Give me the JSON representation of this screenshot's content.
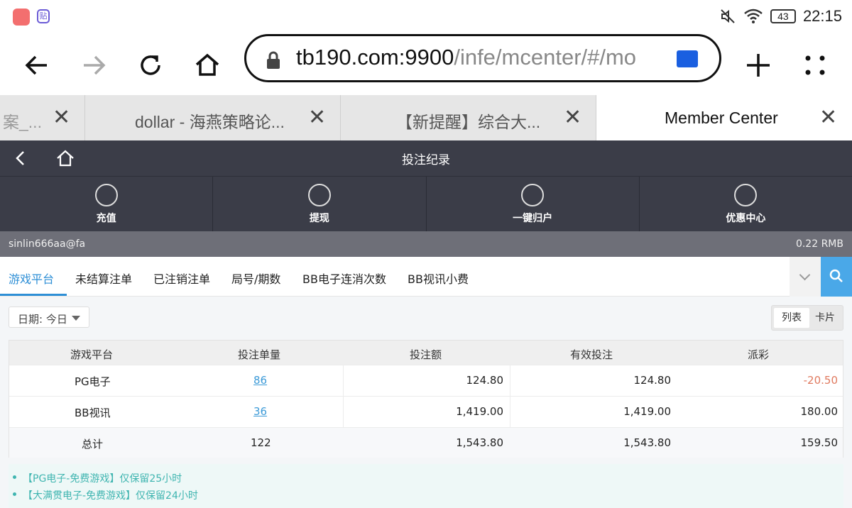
{
  "statusbar": {
    "app_badge": "贴",
    "battery": "43",
    "time": "22:15"
  },
  "browser": {
    "url_host": "tb190.com:9900",
    "url_path": "/infe/mcenter/#/mo",
    "tabs": [
      {
        "title": "案_..."
      },
      {
        "title": "dollar - 海燕策略论..."
      },
      {
        "title": "【新提醒】综合大..."
      },
      {
        "title": "Member Center"
      }
    ]
  },
  "app": {
    "title": "投注纪录",
    "nav": [
      {
        "label": "充值",
        "icon": "deposit-icon"
      },
      {
        "label": "提现",
        "icon": "withdraw-icon"
      },
      {
        "label": "一键归户",
        "icon": "transfer-icon"
      },
      {
        "label": "优惠中心",
        "icon": "promo-icon"
      }
    ],
    "username": "sinlin666aa@fa",
    "balance": "0.22 RMB"
  },
  "filters": {
    "tabs": [
      "游戏平台",
      "未结算注单",
      "已注销注单",
      "局号/期数",
      "BB电子连消次数",
      "BB视讯小费"
    ],
    "active": 0
  },
  "date_filter": "日期: 今日",
  "view_toggle": {
    "list": "列表",
    "card": "卡片"
  },
  "table": {
    "headers": [
      "游戏平台",
      "投注单量",
      "投注额",
      "有效投注",
      "派彩"
    ],
    "rows": [
      {
        "platform": "PG电子",
        "count": "86",
        "amount": "124.80",
        "valid": "124.80",
        "payout": "-20.50"
      },
      {
        "platform": "BB视讯",
        "count": "36",
        "amount": "1,419.00",
        "valid": "1,419.00",
        "payout": "180.00"
      }
    ],
    "total": {
      "platform": "总计",
      "count": "122",
      "amount": "1,543.80",
      "valid": "1,543.80",
      "payout": "159.50"
    }
  },
  "notes": [
    "【PG电子-免费游戏】仅保留25小时",
    "【大满贯电子-免费游戏】仅保留24小时"
  ],
  "colors": {
    "accent": "#2e8fd6",
    "header_bg": "#3b3d48",
    "negative": "#e07a5f",
    "note": "#3fb5b0"
  }
}
